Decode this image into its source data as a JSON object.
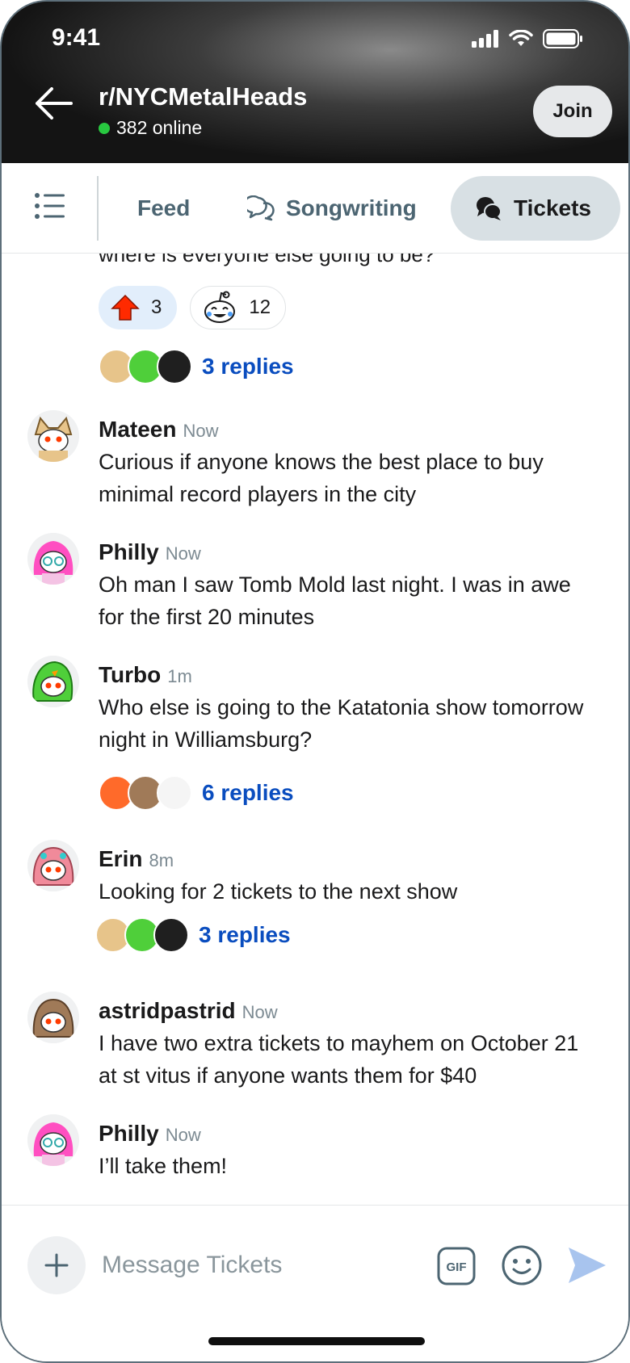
{
  "status_bar": {
    "time": "9:41"
  },
  "header": {
    "title": "r/NYCMetalHeads",
    "online_text": "382 online",
    "join_label": "Join"
  },
  "tabs": [
    {
      "label": "Feed"
    },
    {
      "label": "Songwriting"
    },
    {
      "label": "Tickets",
      "selected": true
    }
  ],
  "partial_message": {
    "text": "where is everyone else going to be?",
    "reactions": [
      {
        "icon": "upvote-icon",
        "count": "3",
        "active": true
      },
      {
        "icon": "laughing-snoo-icon",
        "count": "12",
        "active": false
      }
    ],
    "replies_label": "3 replies"
  },
  "messages": [
    {
      "name": "Mateen",
      "time": "Now",
      "text": "Curious if anyone knows the best place to buy minimal record players in the city",
      "avatar_color": "#e7c48a"
    },
    {
      "name": "Philly",
      "time": "Now",
      "text": "Oh man I saw Tomb Mold last night. I was in awe for the first 20 minutes",
      "avatar_color": "#ff4fc1"
    },
    {
      "name": "Turbo",
      "time": "1m",
      "text": "Who else is going to the Katatonia show tomorrow night in Williamsburg?",
      "avatar_color": "#4fcf3a",
      "replies_label": "6 replies"
    },
    {
      "name": "Erin",
      "time": "8m",
      "text": "Looking for 2 tickets to the next show",
      "avatar_color": "#f08a9a",
      "replies_label": "3 replies"
    },
    {
      "name": "astridpastrid",
      "time": "Now",
      "text": "I have two extra tickets to mayhem on October 21 at st vitus if anyone wants them for $40",
      "avatar_color": "#a07a58"
    },
    {
      "name": "Philly",
      "time": "Now",
      "text": "I’ll take them!",
      "avatar_color": "#ff4fc1"
    }
  ],
  "composer": {
    "placeholder": "Message Tickets"
  },
  "colors": {
    "accent_blue": "#0a4dbf",
    "online_green": "#28c840",
    "selected_tab_bg": "#d8e0e4",
    "send_icon": "#a8c4ee"
  }
}
